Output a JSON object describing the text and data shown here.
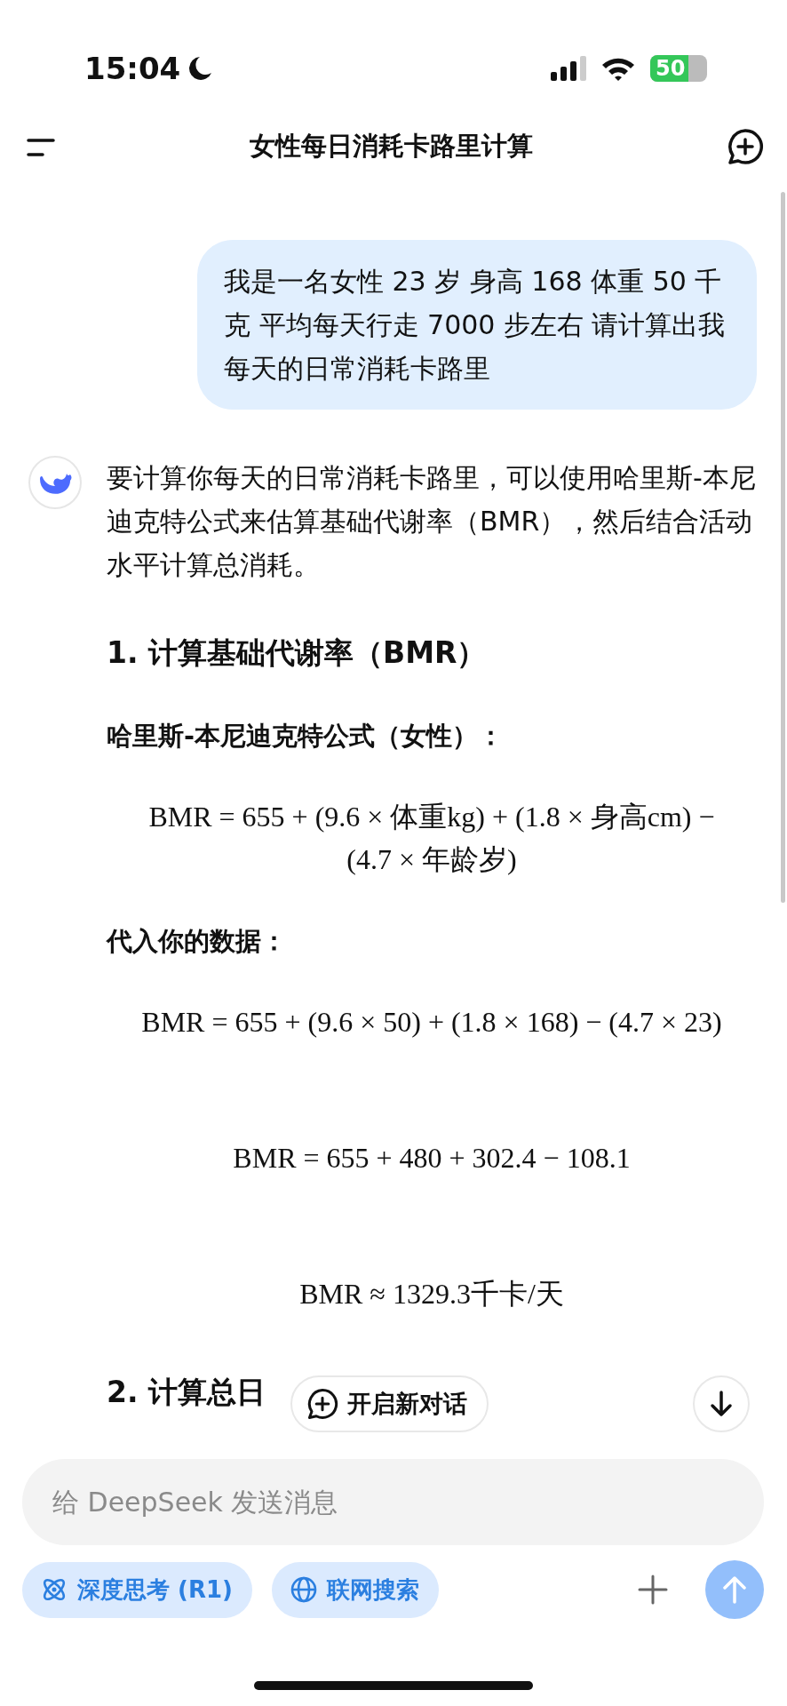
{
  "status_bar": {
    "time": "15:04",
    "battery": "50"
  },
  "nav": {
    "title": "女性每日消耗卡路里计算"
  },
  "messages": [
    {
      "kind": "user",
      "text": "我是一名女性 23 岁 身高 168 体重 50 千克 平均每天行走 7000 步左右 请计算出我每天的日常消耗卡路里"
    },
    {
      "kind": "assistant",
      "blocks": [
        {
          "kind": "paragraph",
          "text": "要计算你每天的日常消耗卡路里，可以使用哈里斯-本尼迪克特公式来估算基础代谢率（BMR），然后结合活动水平计算总消耗。"
        },
        {
          "kind": "heading",
          "text": "1. 计算基础代谢率（BMR）"
        },
        {
          "kind": "label",
          "text": "哈里斯-本尼迪克特公式（女性）："
        },
        {
          "kind": "formula",
          "text": "BMR = 655 + (9.6 × 体重kg) + (1.8 × 身高cm) − (4.7 × 年龄岁)"
        },
        {
          "kind": "label",
          "text": "代入你的数据："
        },
        {
          "kind": "formula",
          "text": "BMR = 655 + (9.6 × 50) + (1.8 × 168) − (4.7 × 23)"
        },
        {
          "kind": "formula",
          "text": "BMR = 655 + 480 + 302.4 − 108.1"
        },
        {
          "kind": "formula",
          "text": "BMR ≈ 1329.3千卡/天"
        },
        {
          "kind": "heading",
          "text": "2. 计算总日"
        }
      ]
    }
  ],
  "new_chat_button": {
    "label": "开启新对话"
  },
  "composer": {
    "placeholder": "给 DeepSeek 发送消息",
    "chips": [
      {
        "kind": "atom",
        "label": "深度思考 (R1)",
        "selected": true
      },
      {
        "kind": "globe",
        "label": "联网搜索",
        "selected": true
      }
    ],
    "send_disabled": true
  }
}
